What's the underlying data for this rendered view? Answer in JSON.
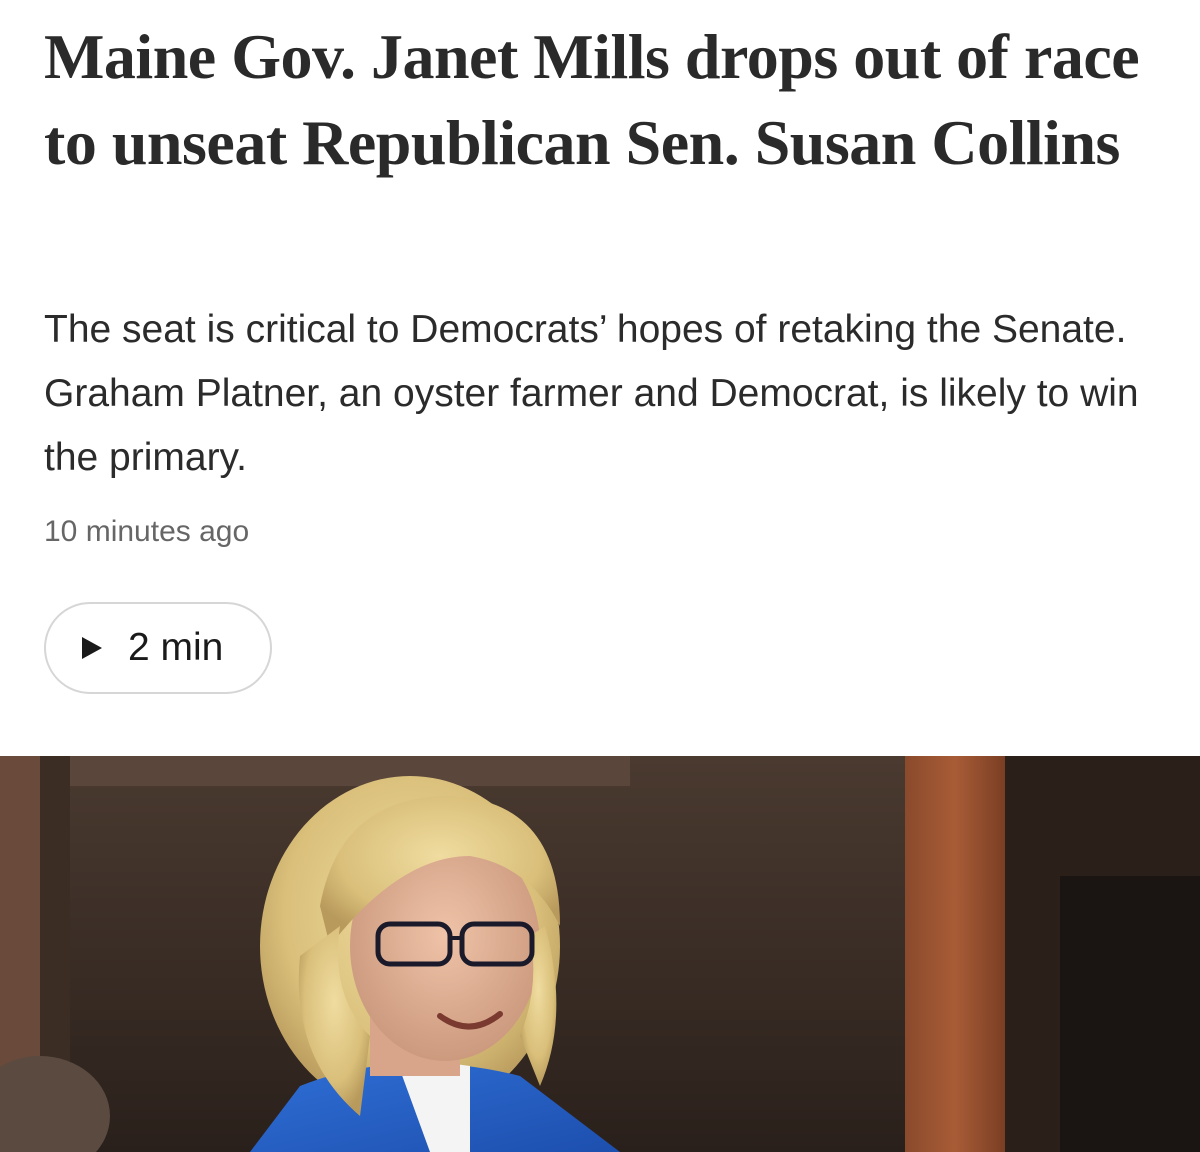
{
  "article": {
    "headline": "Maine Gov. Janet Mills drops out of race to unseat Republican Sen. Susan Collins",
    "dek": "The seat is critical to Democrats’ hopes of retaking the Senate. Graham Platner, an oyster farmer and Democrat, is likely to win the primary.",
    "timestamp": "10 minutes ago",
    "audio": {
      "icon": "play-icon",
      "label": "2 min"
    },
    "photo": {
      "subject": "woman with blonde hair and dark glasses in blue jacket"
    }
  }
}
